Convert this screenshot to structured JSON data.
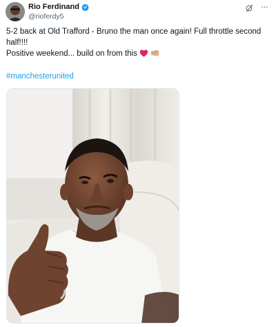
{
  "author": {
    "display_name": "Rio Ferdinand",
    "handle": "@rioferdy5",
    "verified": true
  },
  "tweet": {
    "line1": "5-2 back at Old Trafford - Bruno the man once again! Full throttle second half!!!!",
    "line2": "Positive weekend... build on from this",
    "hashtag": "#manchesterunited"
  },
  "icons": {
    "verified": "verified-badge-icon",
    "grok": "grok-icon",
    "more": "more-options-icon",
    "emoji_heart": "red-heart-emoji",
    "emoji_fist": "fist-bump-emoji"
  },
  "colors": {
    "text": "#0f1419",
    "secondary": "#536471",
    "accent": "#1d9bf0",
    "heart": "#e0245e"
  }
}
